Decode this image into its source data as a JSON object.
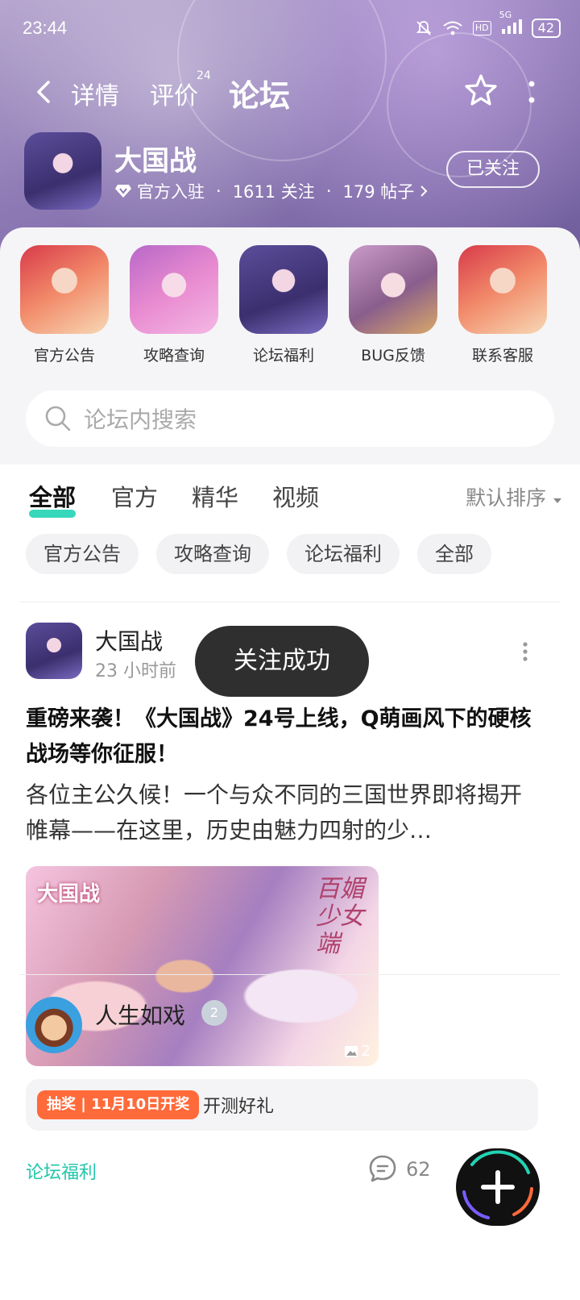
{
  "status_bar": {
    "time": "23:44",
    "battery": "42",
    "network": "5G",
    "hd": "HD"
  },
  "nav": {
    "tabs": [
      {
        "label": "详情"
      },
      {
        "label": "评价",
        "badge": "24"
      },
      {
        "label": "论坛"
      }
    ],
    "active_tab": "论坛"
  },
  "game": {
    "name": "大国战",
    "badge": "官方入驻",
    "followers": "1611 关注",
    "posts": "179 帖子",
    "follow_label": "已关注",
    "separator": "·"
  },
  "shortcuts": [
    {
      "label": "官方公告"
    },
    {
      "label": "攻略查询"
    },
    {
      "label": "论坛福利"
    },
    {
      "label": "BUG反馈"
    },
    {
      "label": "联系客服"
    }
  ],
  "search": {
    "placeholder": "论坛内搜索"
  },
  "tabs": [
    {
      "label": "全部"
    },
    {
      "label": "官方"
    },
    {
      "label": "精华"
    },
    {
      "label": "视频"
    }
  ],
  "sort_label": "默认排序",
  "chips": [
    {
      "label": "官方公告"
    },
    {
      "label": "攻略查询"
    },
    {
      "label": "论坛福利"
    },
    {
      "label": "全部"
    }
  ],
  "post": {
    "author": "大国战",
    "time": "23 小时前",
    "title": "重磅来袭！《大国战》24号上线，Q萌画风下的硬核战场等你征服！",
    "body": "各位主公久候！一个与众不同的三国世界即将揭开帷幕——在这里，历史由魅力四射的少…",
    "image_count": "2",
    "image_art_title": "百媚少女端",
    "image_art_logo": "大国战",
    "lottery_tag": "抽奖 | 11月10日开奖",
    "lottery_text": "开测好礼",
    "forum_tag": "论坛福利",
    "comments": "62"
  },
  "post2": {
    "author": "人生如戏",
    "badge": "2"
  },
  "toast": "关注成功",
  "colors": {
    "accent": "#21d3b4",
    "lottery": "#ff6a3a",
    "tag": "#21c6aa",
    "toast_bg": "#2f2f2f"
  }
}
